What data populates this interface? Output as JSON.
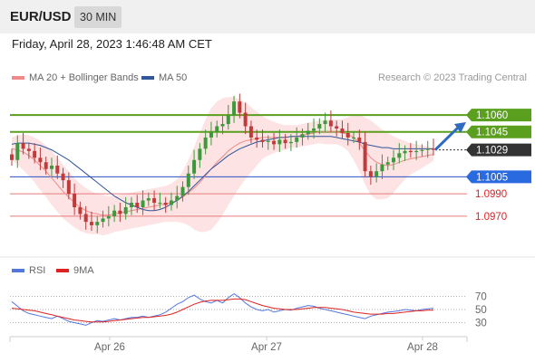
{
  "header": {
    "symbol": "EUR/USD",
    "timeframe": "30 MIN"
  },
  "datetime": "Friday, April 28, 2023 1:46:48 AM CET",
  "legend": {
    "ma20": {
      "label": "MA 20 + Bollinger Bands",
      "color": "#f08a8a"
    },
    "ma50": {
      "label": "MA 50",
      "color": "#33559a"
    }
  },
  "credit": "Research © 2023 Trading Central",
  "rsi_legend": {
    "rsi": {
      "label": "RSI",
      "color": "#5577dd"
    },
    "ma9": {
      "label": "9MA",
      "color": "#dd2222"
    }
  },
  "chart_data": {
    "type": "candlestick",
    "ylim": [
      1.0945,
      1.1085
    ],
    "levels": [
      {
        "label": "1.1060",
        "value": 1.106,
        "style": "green-box"
      },
      {
        "label": "1.1045",
        "value": 1.1045,
        "style": "green-box"
      },
      {
        "label": "1.1029",
        "value": 1.1029,
        "style": "dark-box"
      },
      {
        "label": "1.1005",
        "value": 1.1005,
        "style": "blue-box"
      },
      {
        "label": "1.0990",
        "value": 1.099,
        "style": "red-text"
      },
      {
        "label": "1.0970",
        "value": 1.097,
        "style": "red-text"
      }
    ],
    "x_ticks": [
      "Apr 26",
      "Apr 27",
      "Apr 28"
    ],
    "rsi_ticks": [
      "70",
      "50",
      "30"
    ],
    "rsi_ylim": [
      10,
      90
    ],
    "close_series": [
      1.102,
      1.1035,
      1.103,
      1.1028,
      1.1022,
      1.1018,
      1.1012,
      1.1015,
      1.1008,
      1.1002,
      1.099,
      1.0978,
      1.0972,
      1.0965,
      1.0962,
      1.0965,
      1.0968,
      1.097,
      1.0975,
      1.0972,
      1.0978,
      1.0982,
      1.0978,
      1.0984,
      1.0986,
      1.0982,
      1.0982,
      1.098,
      1.0984,
      1.0988,
      1.0996,
      1.1008,
      1.102,
      1.103,
      1.104,
      1.1045,
      1.105,
      1.1052,
      1.106,
      1.1072,
      1.1062,
      1.105,
      1.104,
      1.1038,
      1.1036,
      1.1037,
      1.1034,
      1.1038,
      1.1035,
      1.1036,
      1.104,
      1.1043,
      1.1046,
      1.1048,
      1.1052,
      1.1055,
      1.105,
      1.1048,
      1.1044,
      1.104,
      1.104,
      1.1036,
      1.101,
      1.1005,
      1.101,
      1.1016,
      1.1018,
      1.1022,
      1.1026,
      1.1028,
      1.1027,
      1.1028,
      1.1029,
      1.103,
      1.1029
    ],
    "ma20_series": [
      1.103,
      1.1029,
      1.1027,
      1.1024,
      1.102,
      1.1015,
      1.101,
      1.1004,
      1.0998,
      1.0992,
      1.0987,
      1.0982,
      1.0978,
      1.0975,
      1.0973,
      1.0972,
      1.0971,
      1.0971,
      1.0972,
      1.0973,
      1.0974,
      1.0975,
      1.0976,
      1.0977,
      1.0978,
      1.0979,
      1.098,
      1.0981,
      1.0982,
      1.0984,
      1.0987,
      1.0991,
      1.0995,
      1.1,
      1.1006,
      1.1012,
      1.1018,
      1.1023,
      1.1028,
      1.1032,
      1.1035,
      1.1037,
      1.1038,
      1.1039,
      1.104,
      1.104,
      1.104,
      1.104,
      1.104,
      1.1041,
      1.1041,
      1.1042,
      1.1043,
      1.1044,
      1.1045,
      1.1045,
      1.1045,
      1.1045,
      1.1044,
      1.1043,
      1.104,
      1.1035,
      1.1028,
      1.1022,
      1.1018,
      1.1016,
      1.1015,
      1.1016,
      1.1018,
      1.102,
      1.1021,
      1.1022,
      1.1023,
      1.1024,
      1.1025
    ],
    "bb_upper": [
      1.104,
      1.1042,
      1.1043,
      1.1042,
      1.104,
      1.1037,
      1.1033,
      1.1028,
      1.1022,
      1.1016,
      1.101,
      1.1004,
      1.0999,
      1.0995,
      1.0992,
      1.099,
      1.0989,
      1.0988,
      1.0988,
      1.0989,
      1.099,
      1.0991,
      1.0992,
      1.0993,
      1.0994,
      1.0995,
      1.0996,
      1.0997,
      1.0999,
      1.1003,
      1.101,
      1.102,
      1.1032,
      1.1044,
      1.1056,
      1.1066,
      1.1072,
      1.1075,
      1.1076,
      1.1076,
      1.1074,
      1.1071,
      1.1067,
      1.1063,
      1.1059,
      1.1056,
      1.1054,
      1.1052,
      1.1051,
      1.1051,
      1.1051,
      1.1052,
      1.1053,
      1.1054,
      1.1055,
      1.1056,
      1.1056,
      1.1056,
      1.1056,
      1.1058,
      1.106,
      1.106,
      1.1058,
      1.1055,
      1.1051,
      1.1047,
      1.1044,
      1.1041,
      1.1039,
      1.1037,
      1.1035,
      1.1034,
      1.1033,
      1.1032,
      1.1031
    ],
    "bb_lower": [
      1.102,
      1.1016,
      1.1011,
      1.1006,
      1.1,
      1.0993,
      1.0987,
      1.098,
      1.0974,
      1.0968,
      1.0964,
      1.096,
      1.0957,
      1.0955,
      1.0954,
      1.0954,
      1.0953,
      1.0954,
      1.0956,
      1.0957,
      1.0958,
      1.0959,
      1.096,
      1.0961,
      1.0962,
      1.0963,
      1.0964,
      1.0965,
      1.0965,
      1.0965,
      1.0964,
      1.0962,
      1.0958,
      1.0956,
      1.0956,
      1.0958,
      1.0964,
      1.0971,
      1.098,
      1.0988,
      1.0996,
      1.1003,
      1.1009,
      1.1015,
      1.1021,
      1.1024,
      1.1026,
      1.1028,
      1.1029,
      1.1031,
      1.1031,
      1.1032,
      1.1033,
      1.1034,
      1.1035,
      1.1034,
      1.1034,
      1.1034,
      1.1032,
      1.1028,
      1.102,
      1.101,
      1.0998,
      1.0989,
      1.0985,
      1.0985,
      1.0986,
      1.0991,
      1.0997,
      1.1003,
      1.1007,
      1.101,
      1.1013,
      1.1016,
      1.1019
    ],
    "ma50_series": [
      1.1034,
      1.1035,
      1.1035,
      1.1035,
      1.1034,
      1.1033,
      1.1031,
      1.1029,
      1.1026,
      1.1023,
      1.102,
      1.1016,
      1.1012,
      1.1008,
      1.1004,
      1.1,
      1.0996,
      1.0992,
      1.0988,
      1.0985,
      1.0982,
      1.098,
      1.0978,
      1.0976,
      1.0975,
      1.0975,
      1.0976,
      1.0978,
      1.0981,
      1.0984,
      1.0988,
      1.0992,
      1.0997,
      1.1002,
      1.1007,
      1.1012,
      1.1016,
      1.102,
      1.1024,
      1.1027,
      1.103,
      1.1032,
      1.1034,
      1.1036,
      1.1037,
      1.1038,
      1.1039,
      1.104,
      1.104,
      1.1041,
      1.1041,
      1.1041,
      1.1041,
      1.1041,
      1.1041,
      1.1041,
      1.1041,
      1.104,
      1.1039,
      1.1038,
      1.1037,
      1.1036,
      1.1034,
      1.1033,
      1.1032,
      1.1031,
      1.1031,
      1.103,
      1.103,
      1.103,
      1.103,
      1.103,
      1.103,
      1.103,
      1.103
    ],
    "rsi_series": [
      62,
      55,
      48,
      44,
      42,
      40,
      38,
      36,
      40,
      36,
      32,
      30,
      28,
      26,
      30,
      33,
      32,
      34,
      36,
      34,
      36,
      38,
      38,
      40,
      38,
      40,
      42,
      46,
      52,
      58,
      62,
      68,
      72,
      66,
      62,
      60,
      64,
      60,
      68,
      74,
      68,
      60,
      54,
      50,
      48,
      50,
      46,
      48,
      50,
      49,
      52,
      54,
      56,
      55,
      52,
      50,
      48,
      46,
      44,
      42,
      40,
      38,
      36,
      40,
      42,
      44,
      46,
      47,
      48,
      50,
      49,
      48,
      50,
      51,
      52
    ],
    "rsi_ma_series": [
      52,
      51,
      50,
      49,
      48,
      46,
      44,
      42,
      40,
      38,
      36,
      34,
      33,
      32,
      31,
      31,
      31,
      32,
      33,
      34,
      35,
      36,
      37,
      38,
      38,
      39,
      40,
      41,
      43,
      46,
      50,
      54,
      58,
      61,
      63,
      64,
      64,
      64,
      65,
      66,
      66,
      65,
      62,
      59,
      56,
      54,
      52,
      51,
      50,
      50,
      50,
      51,
      52,
      53,
      53,
      53,
      52,
      51,
      50,
      48,
      46,
      45,
      44,
      43,
      43,
      43,
      44,
      44,
      45,
      46,
      47,
      48,
      48,
      49,
      49
    ]
  }
}
